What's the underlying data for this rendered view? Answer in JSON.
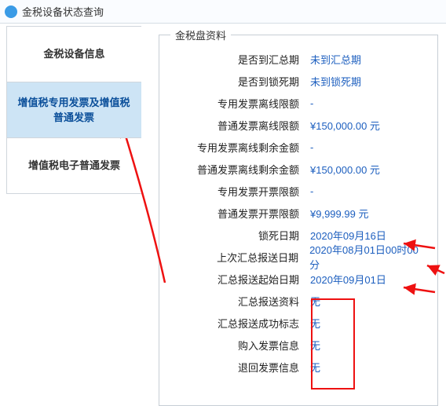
{
  "window": {
    "title": "金税设备状态查询"
  },
  "sidebar": {
    "items": [
      {
        "label": "金税设备信息"
      },
      {
        "label": "增值税专用发票及增值税普通发票"
      },
      {
        "label": "增值税电子普通发票"
      }
    ],
    "selected_index": 1
  },
  "panel": {
    "legend": "金税盘资料",
    "rows": [
      {
        "label": "是否到汇总期",
        "value": "未到汇总期"
      },
      {
        "label": "是否到锁死期",
        "value": "未到锁死期"
      },
      {
        "label": "专用发票离线限额",
        "value": "-"
      },
      {
        "label": "普通发票离线限额",
        "value": "¥150,000.00 元"
      },
      {
        "label": "专用发票离线剩余金额",
        "value": "-"
      },
      {
        "label": "普通发票离线剩余金额",
        "value": "¥150,000.00 元"
      },
      {
        "label": "专用发票开票限额",
        "value": "-"
      },
      {
        "label": "普通发票开票限额",
        "value": "¥9,999.99 元"
      },
      {
        "label": "锁死日期",
        "value": "2020年09月16日"
      },
      {
        "label": "上次汇总报送日期",
        "value": "2020年08月01日00时00分"
      },
      {
        "label": "汇总报送起始日期",
        "value": "2020年09月01日"
      },
      {
        "label": "汇总报送资料",
        "value": "无"
      },
      {
        "label": "汇总报送成功标志",
        "value": "无"
      },
      {
        "label": "购入发票信息",
        "value": "无"
      },
      {
        "label": "退回发票信息",
        "value": "无"
      }
    ]
  }
}
